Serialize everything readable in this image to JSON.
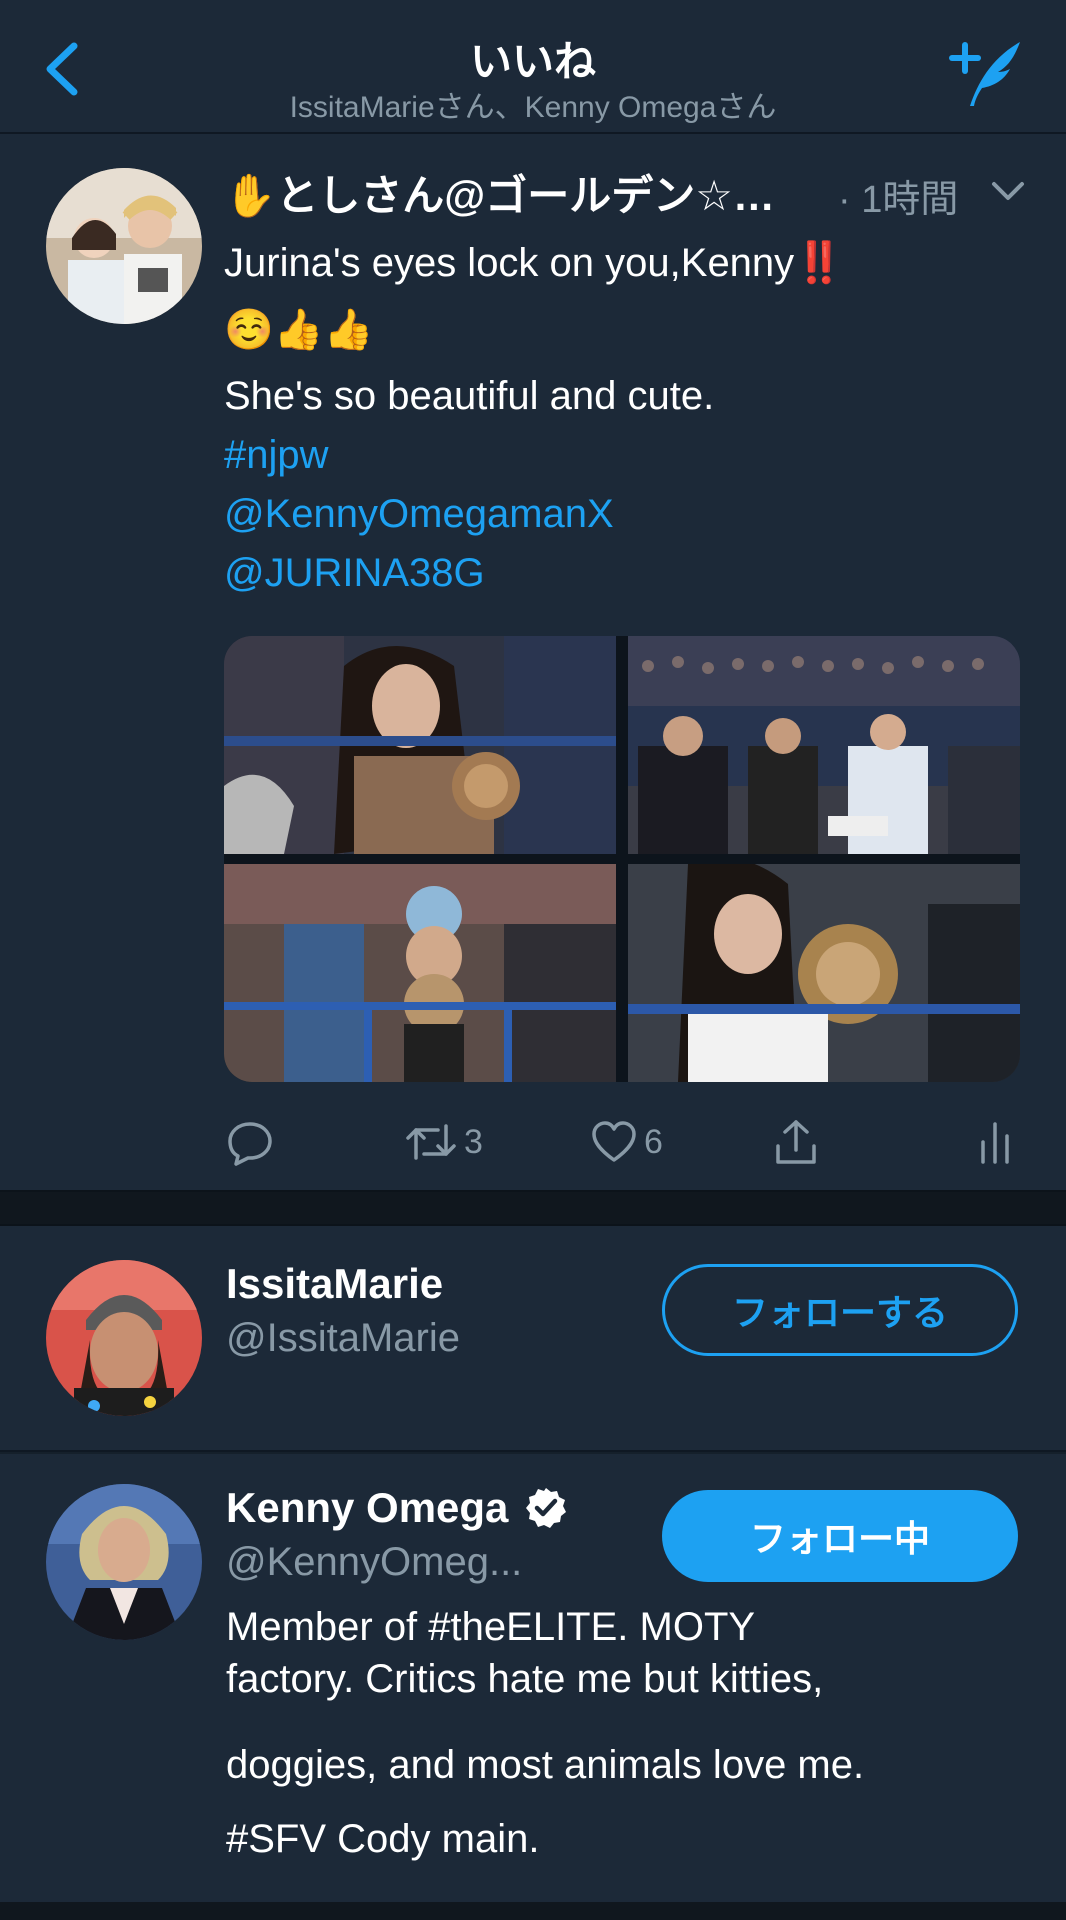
{
  "nav": {
    "title": "いいね",
    "subtitle": "IssitaMarieさん、Kenny Omegaさん",
    "back_icon": "chevron-left-icon",
    "compose_icon": "compose-tweet-icon",
    "accent": "#1da1f2"
  },
  "tweet": {
    "author_emoji": "✋",
    "author": "としさん@ゴールデン☆…",
    "time": "· 1時間",
    "text_line1": "Jurina's eyes lock on you,Kenny‼️",
    "text_line2": "☺️👍👍",
    "text_line3": "She's so beautiful and cute.",
    "hashtag": "#njpw",
    "mention1": "@KennyOmegamanX",
    "mention2": "@JURINA38G",
    "retweet_count": "3",
    "like_count": "6"
  },
  "users": [
    {
      "name": "IssitaMarie",
      "handle": "@IssitaMarie",
      "button_label": "フォローする",
      "following": false
    },
    {
      "name": "Kenny Omega",
      "handle": "@KennyOmeg...",
      "verified": true,
      "button_label": "フォロー中",
      "following": true,
      "bio_line1": "Member of #theELITE. MOTY",
      "bio_line2": "factory. Critics hate me but kitties,",
      "bio_line3": "doggies, and most animals love me.",
      "bio_line4": "#SFV Cody main."
    }
  ],
  "colors": {
    "background": "#15202b",
    "card": "#1c2938",
    "secondary_text": "#8899a6",
    "link": "#1da1f2"
  }
}
